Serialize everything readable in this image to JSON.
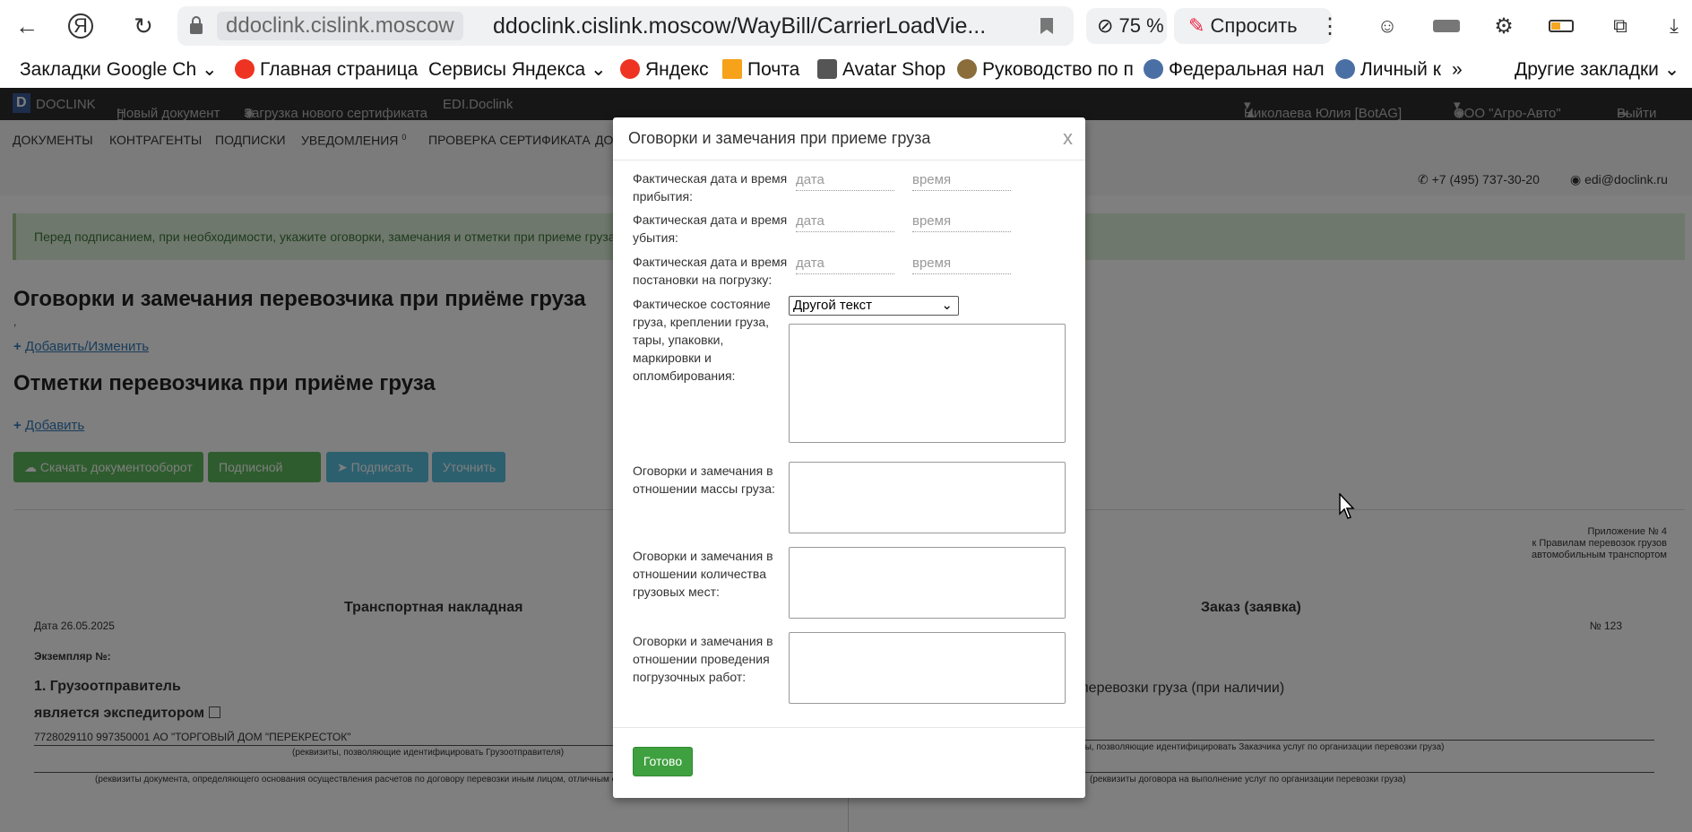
{
  "browser": {
    "url_domain": "ddoclink.cislink.moscow",
    "url_full": "ddoclink.cislink.moscow/WayBill/CarrierLoadVie...",
    "zoom": "75 %",
    "ask_label": "Спросить",
    "bookmarks": [
      "Закладки Google Ch",
      "Главная страница",
      "Сервисы Яндекса",
      "Яндекс",
      "Почта",
      "Avatar Shop",
      "Руководство по п",
      "Федеральная нал",
      "Личный к",
      "Другие закладки"
    ]
  },
  "appbar": {
    "logo": "DOCLINK",
    "new_doc": "Новый документ",
    "cert_upload": "Загрузка нового сертификата",
    "edi": "EDI.Doclink",
    "user": "Николаева Юлия [BotAG]",
    "org": "ООО \"Агро-Авто\"",
    "logout": "Выйти"
  },
  "menu": {
    "items": [
      "ДОКУМЕНТЫ",
      "КОНТРАГЕНТЫ",
      "ПОДПИСКИ",
      "УВЕДОМЛЕНИЯ",
      "ПРОВЕРКА СЕРТИФИКАТА",
      "ДО"
    ],
    "notif_count": "0",
    "phone": "+7 (495) 737-30-20",
    "email": "edi@doclink.ru"
  },
  "page": {
    "alert": "Перед подписанием, при необходимости, укажите оговорки, замечания и отметки при приеме груза.",
    "h1": "Оговорки и замечания перевозчика при приёме груза",
    "comma": ",",
    "add_change": "Добавить/Изменить",
    "h2": "Отметки перевозчика при приёме груза",
    "add": "Добавить",
    "buttons": [
      "Скачать документооборот",
      "Подписной лист",
      "Подписать",
      "Уточнить"
    ],
    "appendix": [
      "Приложение № 4",
      "к Правилам перевозок грузов",
      "автомобильным транспортом"
    ],
    "waybill": "Транспортная накладная",
    "order": "Заказ (заявка)",
    "date": "Дата  26.05.2025",
    "number": "№ 123",
    "copy_no": "Экземпляр №:",
    "shipper": "1. Грузоотправитель",
    "forwarder": "является экспедитором",
    "shipper_value": "7728029110 997350001 АО \"ТОРГОВЫЙ ДОМ \"ПЕРЕКРЕСТОК\"",
    "shipper_hint": "(реквизиты, позволяющие идентифицировать Грузоотправителя)",
    "doc_hint": "(реквизиты документа, определяющего основания осуществления расчетов по договору перевозки иным лицом, отличным от грузоотправителя (при наличии))",
    "right_text": "перевозки груза (при наличии)",
    "right_hint": "ты, позволяющие идентифицировать Заказчика услуг по организации перевозки груза)",
    "right_hint2": "(реквизиты договора на выполнение услуг по организации перевозки груза)"
  },
  "modal": {
    "title": "Оговорки и замечания при приеме груза",
    "close": "x",
    "arrival_label": "Фактическая дата и время прибытия:",
    "departure_label": "Фактическая дата и время убытия:",
    "loading_label": "Фактическая дата и время постановки на погрузку:",
    "date_placeholder": "дата",
    "time_placeholder": "время",
    "condition_label": "Фактическое состояние груза, креплении груза, тары, упаковки, маркировки и опломбирования:",
    "condition_select": "Другой текст",
    "mass_label": "Оговорки и замечания в отношении массы груза:",
    "places_label": "Оговорки и замечания в отношении количества грузовых мест:",
    "loading_works_label": "Оговорки и замечания в отношении проведения погрузочных работ:",
    "done": "Готово"
  }
}
